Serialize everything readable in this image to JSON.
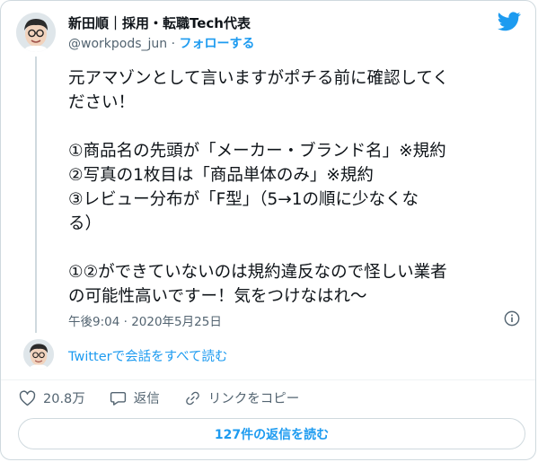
{
  "author": {
    "name": "新田順｜採用・転職Tech代表",
    "handle": "@workpods_jun",
    "separator": "·",
    "follow_label": "フォローする"
  },
  "tweet": {
    "lines": [
      "元アマゾンとして言いますがポチる前に確認してく",
      "ださい！",
      "",
      "①商品名の先頭が「メーカー・ブランド名」※規約",
      "②写真の1枚目は「商品単体のみ」※規約",
      "③レビュー分布が「F型」（5→1の順に少なくな",
      "る）",
      "",
      "①②ができていないのは規約違反なので怪しい業者",
      "の可能性高いですー！気をつけなはれ〜"
    ],
    "timestamp": "午後9:04 · 2020年5月25日"
  },
  "conversation_link": "Twitterで会話をすべて読む",
  "actions": {
    "like_count": "20.8万",
    "reply_label": "返信",
    "copy_link_label": "リンクをコピー"
  },
  "read_replies_label": "127件の返信を読む",
  "icons": {
    "brand": "twitter-bird-icon",
    "info": "info-icon",
    "like": "heart-icon",
    "reply": "reply-bubble-icon",
    "link": "link-icon"
  },
  "colors": {
    "accent": "#1d9bf0",
    "text": "#0f1419",
    "muted": "#536471",
    "border": "#cfd9de"
  }
}
